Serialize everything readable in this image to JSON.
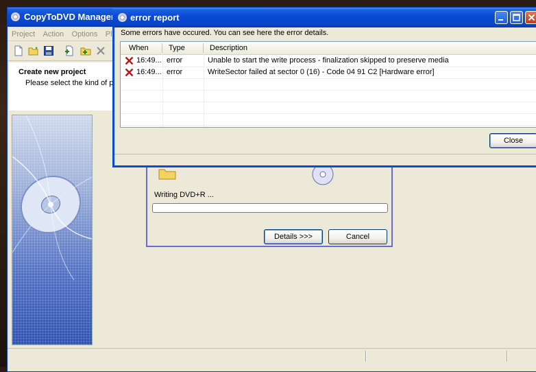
{
  "app": {
    "title": "CopyToDVD Manager",
    "menu": [
      "Project",
      "Action",
      "Options",
      "Pl"
    ],
    "header_title": "Create new project",
    "header_subtitle": "Please select the kind of pr"
  },
  "progress_dialog": {
    "status_text": "Writing DVD+R ...",
    "progress_percent": 0,
    "details_button": "Details >>>",
    "cancel_button": "Cancel"
  },
  "error_dialog": {
    "title": "error report",
    "message": "Some errors have occured. You can see here the error details.",
    "columns": [
      "When",
      "Type",
      "Description"
    ],
    "rows": [
      {
        "when": "16:49...",
        "type": "error",
        "description": "Unable to start the write process - finalization skipped to preserve media"
      },
      {
        "when": "16:49...",
        "type": "error",
        "description": "WriteSector failed at sector 0 (16) - Code 04 91 C2 [Hardware error]"
      }
    ],
    "close_button": "Close"
  },
  "colors": {
    "titlebar": "#0a4bd6",
    "error_icon": "#b01818",
    "dialog_bg": "#ece9d8"
  }
}
